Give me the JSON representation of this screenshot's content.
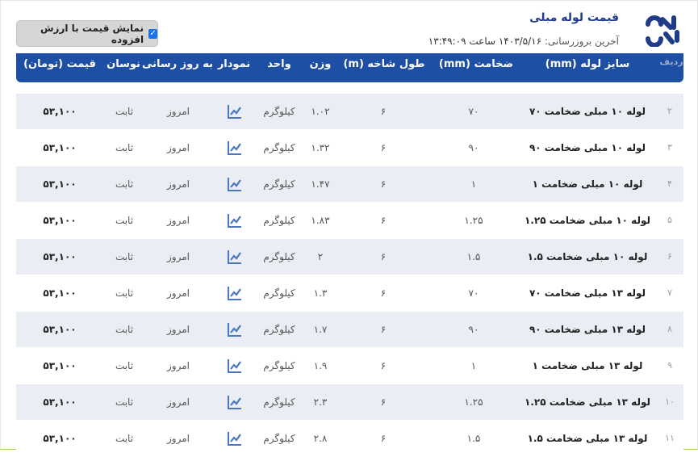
{
  "header": {
    "title": "قیمت لوله مبلی",
    "last_update_label": "آخرین بروزرسانی:",
    "last_update_value": "۱۴۰۳/۵/۱۶ ساعت ۱۳:۴۹:۰۹"
  },
  "vat_toggle": {
    "label": "نمایش قیمت با ارزش افزوده",
    "checked": true
  },
  "table": {
    "headers": {
      "radif": "ردیف",
      "size": "سایز لوله (mm)",
      "thickness": "ضخامت (mm)",
      "length": "طول شاخه (m)",
      "weight": "وزن",
      "unit": "واحد",
      "chart": "نمودار",
      "updated": "به روز رسانی",
      "fluctuation": "نوسان",
      "price": "قیمت (تومان)"
    },
    "rows": [
      {
        "index": "۲",
        "name": "لوله ۱۰ مبلی ضخامت ۷۰",
        "thickness": "۷۰",
        "length": "۶",
        "weight": "۱.۰۲",
        "unit": "کیلوگرم",
        "updated": "امروز",
        "fluctuation": "ثابت",
        "price": "۵۳,۱۰۰"
      },
      {
        "index": "۳",
        "name": "لوله ۱۰ مبلی ضخامت ۹۰",
        "thickness": "۹۰",
        "length": "۶",
        "weight": "۱.۳۲",
        "unit": "کیلوگرم",
        "updated": "امروز",
        "fluctuation": "ثابت",
        "price": "۵۳,۱۰۰"
      },
      {
        "index": "۴",
        "name": "لوله ۱۰ مبلی ضخامت ۱",
        "thickness": "۱",
        "length": "۶",
        "weight": "۱.۴۷",
        "unit": "کیلوگرم",
        "updated": "امروز",
        "fluctuation": "ثابت",
        "price": "۵۳,۱۰۰"
      },
      {
        "index": "۵",
        "name": "لوله ۱۰ مبلی ضخامت ۱.۲۵",
        "thickness": "۱.۲۵",
        "length": "۶",
        "weight": "۱.۸۳",
        "unit": "کیلوگرم",
        "updated": "امروز",
        "fluctuation": "ثابت",
        "price": "۵۳,۱۰۰"
      },
      {
        "index": "۶",
        "name": "لوله ۱۰ مبلی ضخامت ۱.۵",
        "thickness": "۱.۵",
        "length": "۶",
        "weight": "۲",
        "unit": "کیلوگرم",
        "updated": "امروز",
        "fluctuation": "ثابت",
        "price": "۵۳,۱۰۰"
      },
      {
        "index": "۷",
        "name": "لوله ۱۳ مبلی ضخامت ۷۰",
        "thickness": "۷۰",
        "length": "۶",
        "weight": "۱.۳",
        "unit": "کیلوگرم",
        "updated": "امروز",
        "fluctuation": "ثابت",
        "price": "۵۳,۱۰۰"
      },
      {
        "index": "۸",
        "name": "لوله ۱۳ مبلی ضخامت ۹۰",
        "thickness": "۹۰",
        "length": "۶",
        "weight": "۱.۷",
        "unit": "کیلوگرم",
        "updated": "امروز",
        "fluctuation": "ثابت",
        "price": "۵۳,۱۰۰"
      },
      {
        "index": "۹",
        "name": "لوله ۱۳ مبلی ضخامت ۱",
        "thickness": "۱",
        "length": "۶",
        "weight": "۱.۹",
        "unit": "کیلوگرم",
        "updated": "امروز",
        "fluctuation": "ثابت",
        "price": "۵۳,۱۰۰"
      },
      {
        "index": "۱۰",
        "name": "لوله ۱۳ مبلی ضخامت ۱.۲۵",
        "thickness": "۱.۲۵",
        "length": "۶",
        "weight": "۲.۳",
        "unit": "کیلوگرم",
        "updated": "امروز",
        "fluctuation": "ثابت",
        "price": "۵۳,۱۰۰"
      },
      {
        "index": "۱۱",
        "name": "لوله ۱۳ مبلی ضخامت ۱.۵",
        "thickness": "۱.۵",
        "length": "۶",
        "weight": "۲.۸",
        "unit": "کیلوگرم",
        "updated": "امروز",
        "fluctuation": "ثابت",
        "price": "۵۳,۱۰۰"
      }
    ]
  },
  "icons": {
    "logo": "brand-logo-icon",
    "chart": "line-chart-icon",
    "checkbox": "checkbox-checked-icon"
  },
  "colors": {
    "header_bg": "#1d4fa5",
    "accent": "#1f3b8a",
    "row_alt": "#eaedf3",
    "chart_icon": "#4a78c0"
  }
}
